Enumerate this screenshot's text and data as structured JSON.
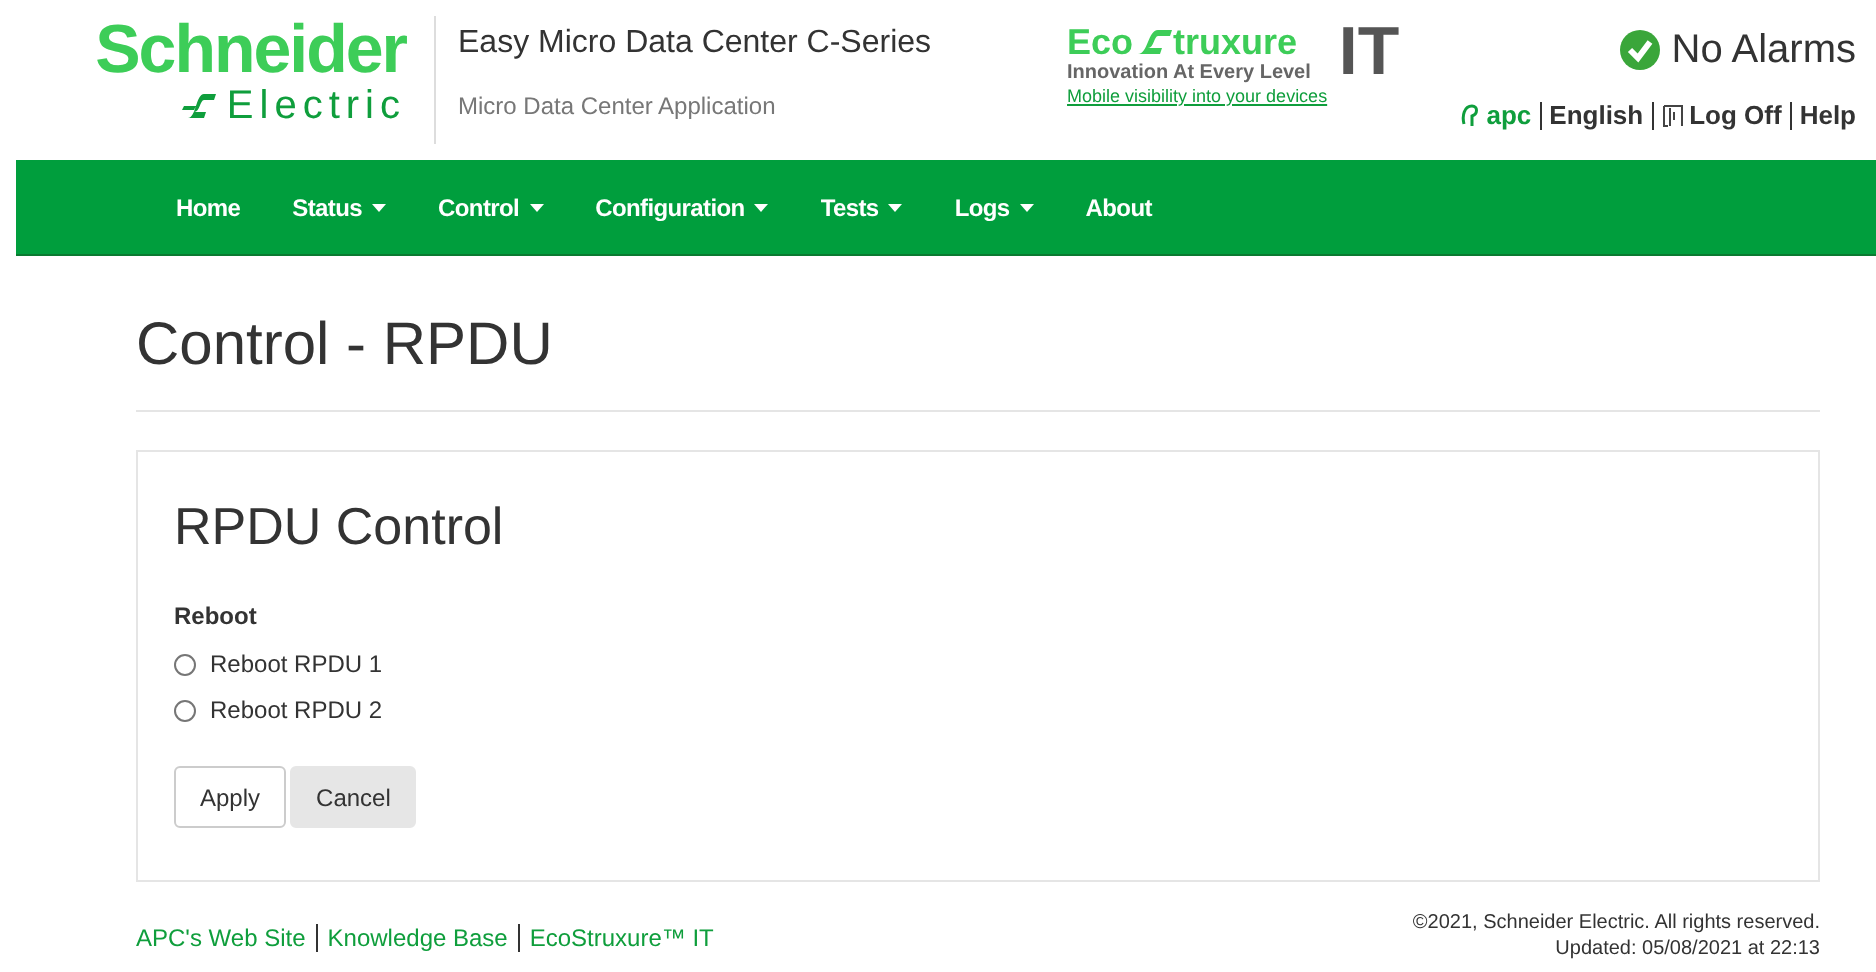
{
  "logo": {
    "line_1": "Schneider",
    "line_2": "Electric"
  },
  "header": {
    "title": "Easy Micro Data Center C-Series",
    "subtitle": "Micro Data Center Application"
  },
  "ecostruxure": {
    "part_1": "Eco",
    "part_2": "truxure",
    "tagline": "Innovation At Every Level",
    "suffix": "IT",
    "link": "Mobile visibility into your devices"
  },
  "alarm_status": {
    "text": "No Alarms"
  },
  "user_links": [
    {
      "kind": "user",
      "label": "apc"
    },
    {
      "kind": "link",
      "label": "English"
    },
    {
      "kind": "logoff",
      "label": "Log Off"
    },
    {
      "kind": "link",
      "label": "Help"
    }
  ],
  "nav": [
    {
      "label": "Home",
      "dropdown": false
    },
    {
      "label": "Status",
      "dropdown": true
    },
    {
      "label": "Control",
      "dropdown": true
    },
    {
      "label": "Configuration",
      "dropdown": true
    },
    {
      "label": "Tests",
      "dropdown": true
    },
    {
      "label": "Logs",
      "dropdown": true
    },
    {
      "label": "About",
      "dropdown": false
    }
  ],
  "page_title": "Control - RPDU",
  "panel": {
    "title": "RPDU Control",
    "group_label": "Reboot",
    "options": [
      {
        "label": "Reboot RPDU 1",
        "selected": false
      },
      {
        "label": "Reboot RPDU 2",
        "selected": false
      }
    ],
    "buttons": [
      {
        "label": "Apply",
        "kind": "primary"
      },
      {
        "label": "Cancel",
        "kind": "secondary"
      }
    ]
  },
  "footer": {
    "links": [
      "APC's Web Site",
      "Knowledge Base",
      "EcoStruxure™ IT"
    ],
    "copyright": "©2021, Schneider Electric. All rights reserved.",
    "updated": "Updated: 05/08/2021 at 22:13"
  }
}
